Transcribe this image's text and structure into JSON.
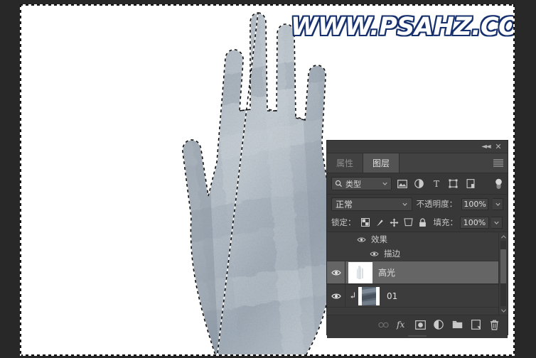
{
  "watermark": {
    "text": "WWW.PSAHZ.COM"
  },
  "canvas": {
    "name": "document-canvas",
    "selection_active": true,
    "artwork": "stone-textured-hand"
  },
  "panel": {
    "titlebar": {
      "collapse_icon": "collapse-icon",
      "close_icon": "close-icon"
    },
    "tabs": [
      {
        "label": "属性",
        "active": false
      },
      {
        "label": "图层",
        "active": true
      }
    ],
    "menu_icon": "hamburger-menu-icon",
    "filter": {
      "search_icon": "search-icon",
      "type_label": "类型",
      "chevron": "chevron-down-icon",
      "icons": [
        "pixel-layer-filter-icon",
        "adjustment-layer-filter-icon",
        "type-layer-filter-icon",
        "shape-layer-filter-icon",
        "smart-object-filter-icon"
      ],
      "toggle_icon": "filter-toggle-icon"
    },
    "blend": {
      "mode": "正常",
      "opacity_label": "不透明度：",
      "opacity_value": "100%"
    },
    "lock": {
      "label": "锁定：",
      "icons": [
        "lock-transparent-pixels-icon",
        "lock-image-pixels-icon",
        "lock-position-icon",
        "lock-artboard-nesting-icon",
        "lock-all-icon"
      ],
      "fill_label": "填充：",
      "fill_value": "100%"
    },
    "effects": [
      {
        "label": "效果",
        "indent": 1,
        "eye_icon": "eye-icon"
      },
      {
        "label": "描边",
        "indent": 2,
        "eye_icon": "eye-icon"
      }
    ],
    "layers": [
      {
        "name": "高光",
        "selected": true,
        "visible": true,
        "eye_icon": "eye-icon",
        "thumbnail": "highlight-layer-thumbnail",
        "clipped": false
      },
      {
        "name": "01",
        "selected": false,
        "visible": true,
        "eye_icon": "eye-icon",
        "thumbnail": "texture-layer-thumbnail",
        "clipped": true,
        "clip_icon": "clipping-mask-icon"
      }
    ],
    "scrollbar": {
      "up_icon": "chevron-up-icon",
      "down_icon": "chevron-down-icon"
    },
    "footer_buttons": [
      {
        "name": "link-layers-button",
        "icon": "link-icon",
        "disabled": true
      },
      {
        "name": "layer-style-button",
        "icon": "fx-icon",
        "disabled": false
      },
      {
        "name": "add-layer-mask-button",
        "icon": "mask-icon",
        "disabled": false
      },
      {
        "name": "new-fill-adjustment-button",
        "icon": "half-circle-icon",
        "disabled": false
      },
      {
        "name": "new-group-button",
        "icon": "folder-icon",
        "disabled": false
      },
      {
        "name": "new-layer-button",
        "icon": "new-layer-icon",
        "disabled": false
      },
      {
        "name": "delete-layer-button",
        "icon": "trash-icon",
        "disabled": false
      }
    ]
  },
  "colors": {
    "panel_bg": "#383838",
    "list_bg": "#3c3c3c",
    "selected_row": "#656565",
    "tab_active": "#535353",
    "text": "#c6c6c6",
    "watermark_fill": "#ffffff",
    "watermark_stroke": "#17306e"
  }
}
